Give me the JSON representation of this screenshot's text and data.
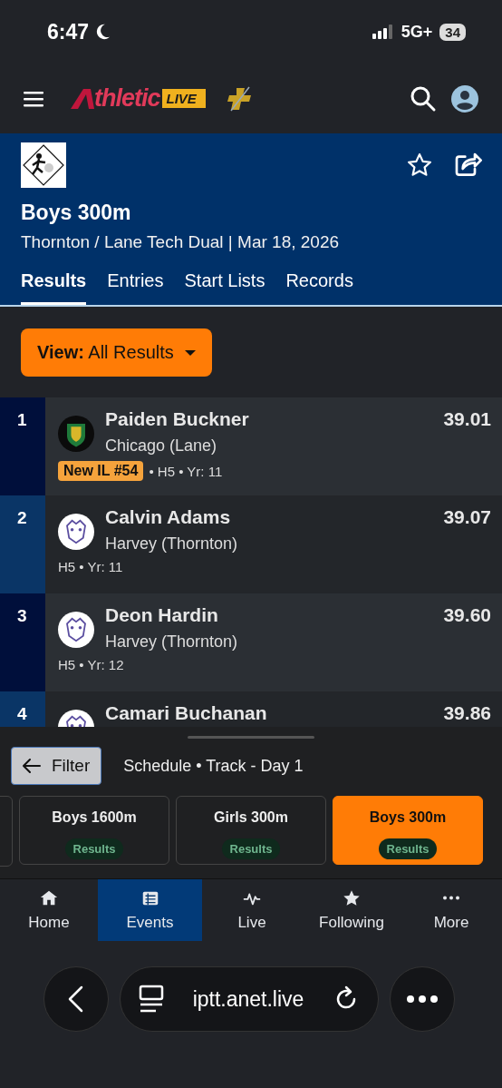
{
  "status_bar": {
    "time": "6:47",
    "network": "5G+",
    "battery": "34"
  },
  "app_bar": {
    "logo_text": "thletic",
    "logo_badge": "LIVE"
  },
  "event_header": {
    "title": "Boys 300m",
    "subtitle": "Thornton / Lane Tech Dual | Mar 18, 2026",
    "tabs": [
      {
        "label": "Results",
        "selected": true
      },
      {
        "label": "Entries",
        "selected": false
      },
      {
        "label": "Start Lists",
        "selected": false
      },
      {
        "label": "Records",
        "selected": false
      }
    ]
  },
  "view_button": {
    "label": "**View:** All Results"
  },
  "results": [
    {
      "place": "1",
      "name": "Paiden Buckner",
      "school": "Chicago (Lane)",
      "time": "39.01",
      "badge": "New IL #54",
      "meta": "• H5 • Yr: 11",
      "kind": "shield"
    },
    {
      "place": "2",
      "name": "Calvin Adams",
      "school": "Harvey (Thornton)",
      "time": "39.07",
      "meta": "H5 • Yr: 11",
      "kind": "round"
    },
    {
      "place": "3",
      "name": "Deon Hardin",
      "school": "Harvey (Thornton)",
      "time": "39.60",
      "meta": "H5 • Yr: 12",
      "kind": "round"
    },
    {
      "place": "4",
      "name": "Camari Buchanan",
      "time": "39.86",
      "kind": "round"
    }
  ],
  "sheet": {
    "filter_label": "Filter",
    "breadcrumb": "Schedule • Track - Day 1",
    "events": [
      {
        "name": "Boys 1600m",
        "status": "Results",
        "selected": false
      },
      {
        "name": "Girls 300m",
        "status": "Results",
        "selected": false
      },
      {
        "name": "Boys 300m",
        "status": "Results",
        "selected": true
      }
    ]
  },
  "bottom_nav": [
    {
      "label": "Home",
      "kind": "home",
      "selected": false
    },
    {
      "label": "Events",
      "kind": "list",
      "selected": true
    },
    {
      "label": "Live",
      "kind": "pulse",
      "selected": false
    },
    {
      "label": "Following",
      "kind": "star",
      "selected": false
    },
    {
      "label": "More",
      "kind": "dots",
      "selected": false
    }
  ],
  "browser": {
    "url": "iptt.anet.live"
  }
}
